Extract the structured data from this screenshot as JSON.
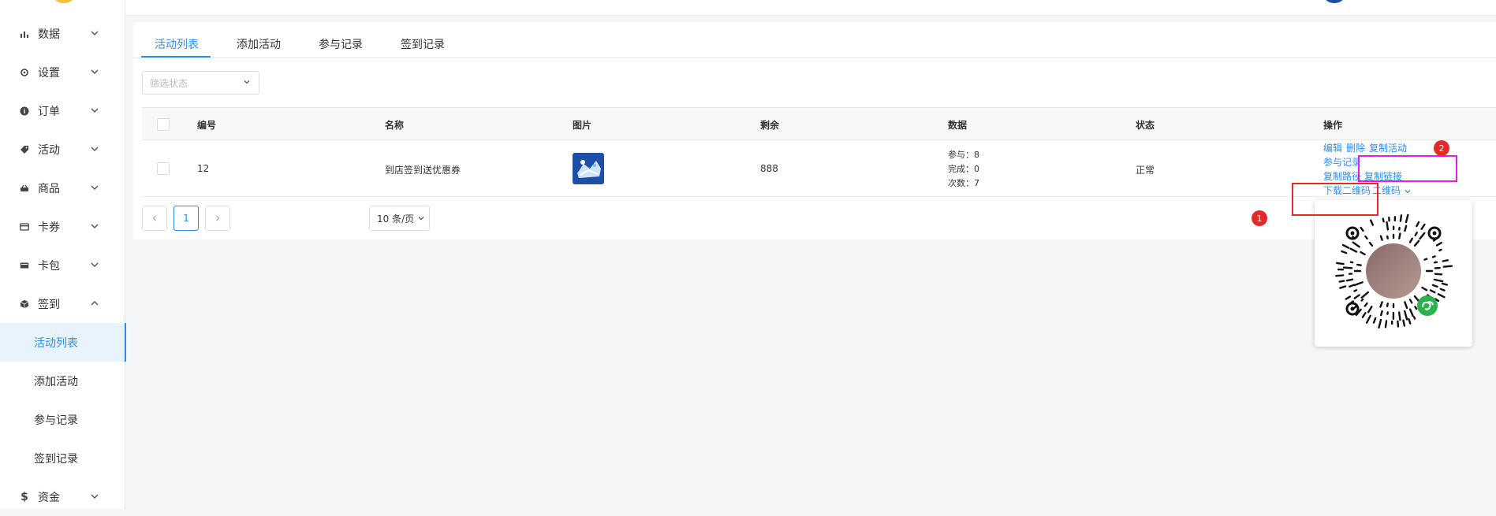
{
  "sidebar": {
    "menu": [
      {
        "label": "数据",
        "icon": "bar-chart-icon"
      },
      {
        "label": "设置",
        "icon": "gear-icon"
      },
      {
        "label": "订单",
        "icon": "info-icon"
      },
      {
        "label": "活动",
        "icon": "tag-icon"
      },
      {
        "label": "商品",
        "icon": "basket-icon"
      },
      {
        "label": "卡券",
        "icon": "card-icon"
      },
      {
        "label": "卡包",
        "icon": "wallet-icon"
      },
      {
        "label": "签到",
        "icon": "cube-icon"
      },
      {
        "label": "资金",
        "icon": "dollar-icon"
      }
    ],
    "sub_menu": [
      {
        "label": "活动列表",
        "active": true
      },
      {
        "label": "添加活动"
      },
      {
        "label": "参与记录"
      },
      {
        "label": "签到记录"
      }
    ]
  },
  "tabs": [
    "活动列表",
    "添加活动",
    "参与记录",
    "签到记录"
  ],
  "filter": {
    "placeholder": "筛选状态"
  },
  "table": {
    "columns": [
      "编号",
      "名称",
      "图片",
      "剩余",
      "数据",
      "状态",
      "操作"
    ],
    "rows": [
      {
        "id": "12",
        "name": "到店签到送优惠券",
        "remaining": "888",
        "stats": [
          "参与：8",
          "完成：0",
          "次数：7"
        ],
        "status": "正常",
        "actions": {
          "edit": "编辑",
          "delete": "删除",
          "copy_activity": "复制活动",
          "records": "参与记录",
          "copy_path": "复制路径",
          "copy_link": "复制链接",
          "download_qr": "下载二维码",
          "qr_code": "二维码"
        }
      }
    ]
  },
  "pagination": {
    "current": "1",
    "page_size": "10 条/页"
  },
  "annotations": {
    "badge_1": "1",
    "badge_2": "2"
  },
  "colors": {
    "accent": "#2d8cf0",
    "annotation_red": "#e52929",
    "annotation_magenta": "#e020e0"
  }
}
